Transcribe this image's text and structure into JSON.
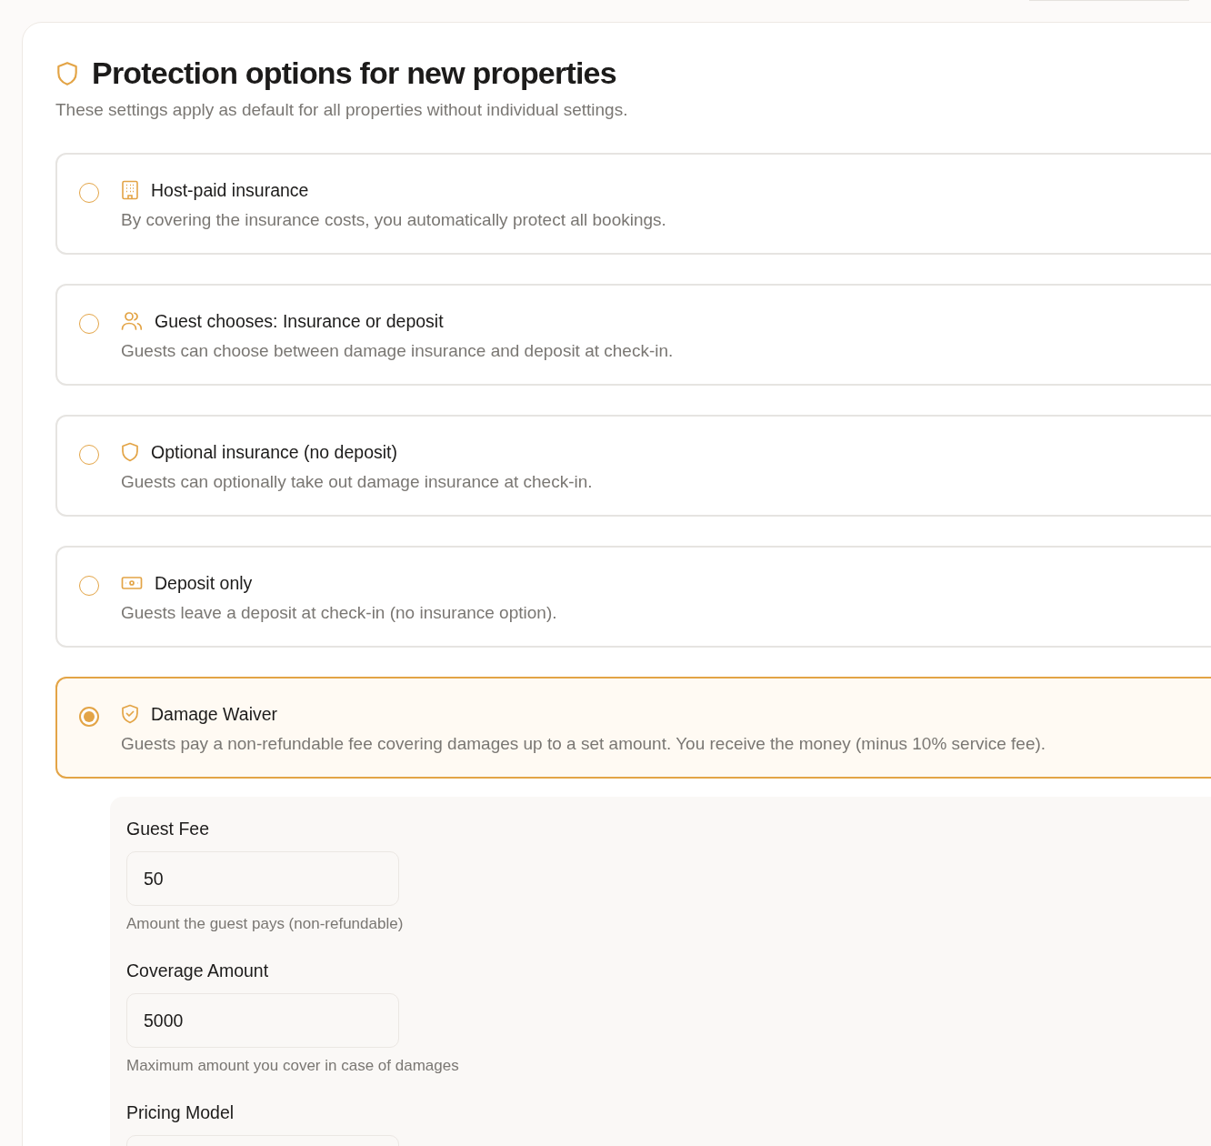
{
  "header": {
    "title": "Protection options for new properties",
    "subtitle": "These settings apply as default for all properties without individual settings."
  },
  "options": [
    {
      "title": "Host-paid insurance",
      "description": "By covering the insurance costs, you automatically protect all bookings.",
      "selected": false
    },
    {
      "title": "Guest chooses: Insurance or deposit",
      "description": "Guests can choose between damage insurance and deposit at check-in.",
      "selected": false
    },
    {
      "title": "Optional insurance (no deposit)",
      "description": "Guests can optionally take out damage insurance at check-in.",
      "selected": false
    },
    {
      "title": "Deposit only",
      "description": "Guests leave a deposit at check-in (no insurance option).",
      "selected": false
    },
    {
      "title": "Damage Waiver",
      "description": "Guests pay a non-refundable fee covering damages up to a set amount. You receive the money (minus 10% service fee).",
      "selected": true
    }
  ],
  "settings": [
    {
      "label": "Guest Fee",
      "value": "50",
      "help": "Amount the guest pays (non-refundable)"
    },
    {
      "label": "Coverage Amount",
      "value": "5000",
      "help": "Maximum amount you cover in case of damages"
    },
    {
      "label": "Pricing Model"
    }
  ]
}
